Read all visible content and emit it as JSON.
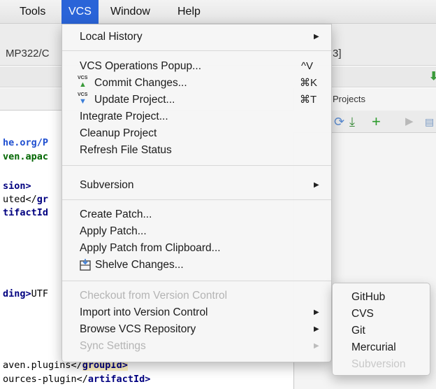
{
  "menubar": {
    "items": [
      {
        "label": "Tools",
        "active": false
      },
      {
        "label": "VCS",
        "active": true
      },
      {
        "label": "Window",
        "active": false
      },
      {
        "label": "Help",
        "active": false
      }
    ]
  },
  "background": {
    "path_fragment": "MP322/C",
    "path_right_fragment": "3]",
    "projects_label": "Projects",
    "code_lines": [
      {
        "prefix": "",
        "token": "he.org/P",
        "style": "link"
      },
      {
        "prefix": "",
        "token": "ven.apac",
        "style": "str"
      },
      {
        "prefix": "",
        "token": "sion>",
        "style": "tag"
      },
      {
        "prefix": "uted</",
        "token": "gr",
        "style": "tag"
      },
      {
        "prefix": "",
        "token": "tifactId",
        "style": "tag"
      },
      {
        "prefix": "",
        "token": "ding>",
        "style": "tag",
        "suffix": "UTF"
      },
      {
        "prefix": "aven.plugins</",
        "token": "groupId>",
        "style": "tag"
      },
      {
        "prefix": "ources-plugin</",
        "token": "artifactId>",
        "style": "tag"
      }
    ]
  },
  "vcs_menu": {
    "local_history": "Local History",
    "ops_popup": "VCS Operations Popup...",
    "ops_popup_shortcut": "^V",
    "commit": "Commit Changes...",
    "commit_shortcut": "⌘K",
    "update": "Update Project...",
    "update_shortcut": "⌘T",
    "integrate": "Integrate Project...",
    "cleanup": "Cleanup Project",
    "refresh": "Refresh File Status",
    "subversion": "Subversion",
    "create_patch": "Create Patch...",
    "apply_patch": "Apply Patch...",
    "apply_patch_clipboard": "Apply Patch from Clipboard...",
    "shelve": "Shelve Changes...",
    "checkout": "Checkout from Version Control",
    "import": "Import into Version Control",
    "browse": "Browse VCS Repository",
    "sync": "Sync Settings",
    "icon_text": "VCS"
  },
  "submenu": {
    "items": [
      {
        "label": "GitHub",
        "enabled": true
      },
      {
        "label": "CVS",
        "enabled": true
      },
      {
        "label": "Git",
        "enabled": true
      },
      {
        "label": "Mercurial",
        "enabled": true
      },
      {
        "label": "Subversion",
        "enabled": false
      }
    ]
  },
  "colors": {
    "menubar_active": "#2a64d8",
    "update_arrow": "#3b7ed8",
    "commit_arrow": "#3a9a3a"
  }
}
